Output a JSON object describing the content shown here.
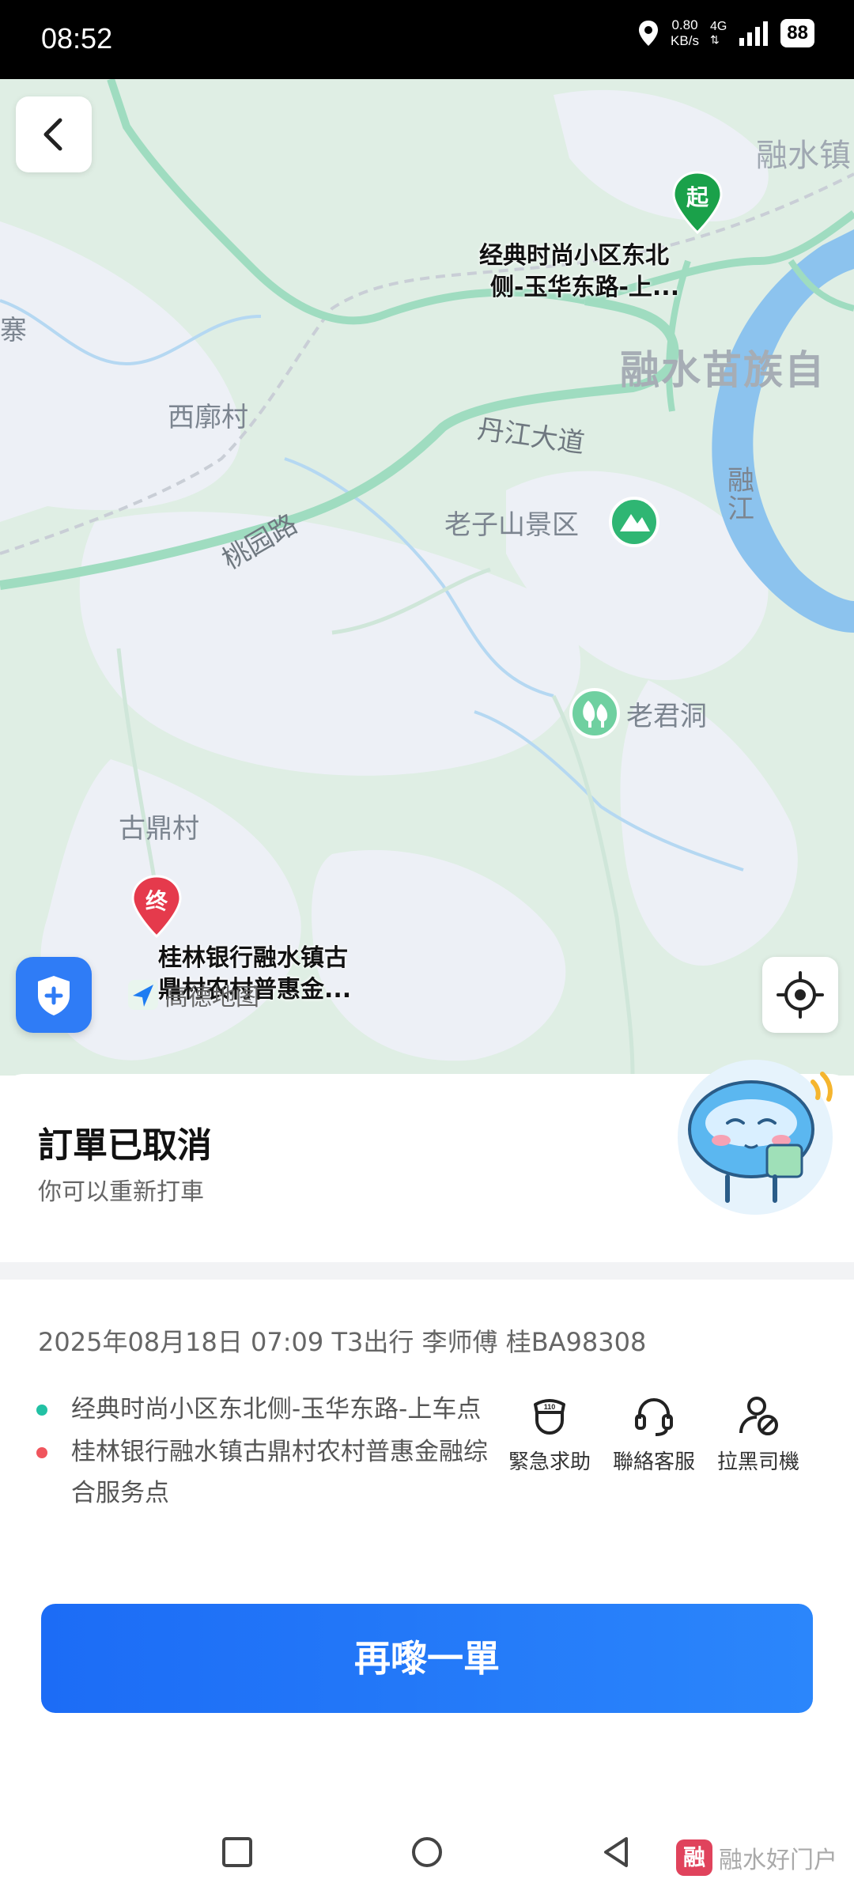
{
  "status_bar": {
    "time": "08:52",
    "speed_value": "0.80",
    "speed_unit": "KB/s",
    "network": "4G",
    "battery": "88"
  },
  "map": {
    "labels": {
      "rongshui_town": "融水镇",
      "autonomous": "融水苗族自",
      "zhai": "寨",
      "xilang": "西廓村",
      "danjiang_road": "丹江大道",
      "taoyuan_road": "桃园路",
      "laozishan": "老子山景区",
      "rongjiang": "融江",
      "laojundong": "老君洞",
      "guding": "古鼎村"
    },
    "start_marker": "起",
    "end_marker": "终",
    "start_label_line1": "经典时尚小区东北",
    "start_label_line2": "侧-玉华东路-上...",
    "end_label_line1": "桂林银行融水镇古",
    "end_label_line2": "鼎村农村普惠金...",
    "amap_text": "高德地图",
    "colors": {
      "land": "#dfeee4",
      "water": "#8cc3ee",
      "road": "#9fdcc0",
      "start": "#1aa14a",
      "end": "#e53a4c"
    }
  },
  "order": {
    "status_title": "訂單已取消",
    "status_subtitle": "你可以重新打車",
    "trip_info": "2025年08月18日 07:09 T3出行 李师傅 桂BA98308",
    "pickup": "经典时尚小区东北侧-玉华东路-上车点",
    "dropoff": "桂林银行融水镇古鼎村农村普惠金融综合服务点",
    "pickup_color": "#22c1a4",
    "dropoff_color": "#f0555d"
  },
  "actions": {
    "emergency": "緊急求助",
    "emergency_badge": "110",
    "service": "聯絡客服",
    "block": "拉黑司機"
  },
  "rebook_button": "再嚟一單",
  "watermark": {
    "logo": "融",
    "text": "融水好门户"
  }
}
